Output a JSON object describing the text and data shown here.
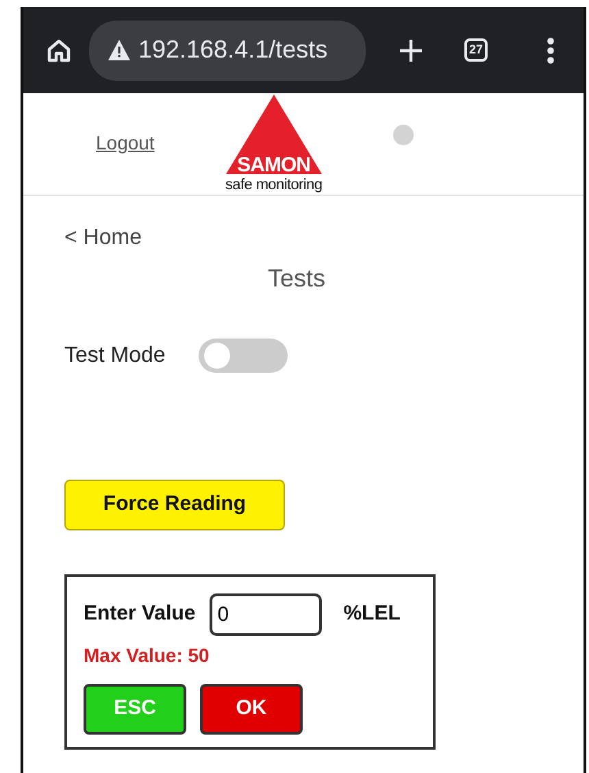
{
  "browser": {
    "url": "192.168.4.1/tests",
    "tab_count": "27"
  },
  "header": {
    "logout": "Logout",
    "logo_name": "SAMON",
    "logo_tagline": "safe monitoring"
  },
  "back_link": "< Home",
  "page_title": "Tests",
  "test_mode": {
    "label": "Test Mode",
    "on": false
  },
  "force_button": "Force Reading",
  "entry": {
    "label": "Enter Value",
    "value": "0",
    "unit": "%LEL",
    "hint": "Max Value: 50",
    "buttons": [
      {
        "label": "ESC",
        "kind": "cancel"
      },
      {
        "label": "OK",
        "kind": "confirm"
      }
    ]
  }
}
